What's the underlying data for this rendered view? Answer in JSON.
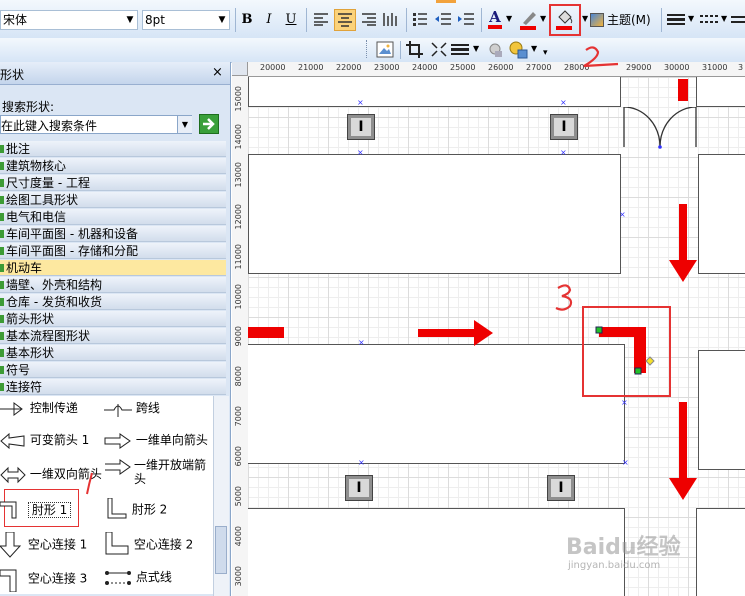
{
  "toolbar": {
    "font_name": "宋体",
    "font_size": "8pt",
    "bold": "B",
    "italic": "I",
    "underline": "U",
    "theme_label": "主题(M)",
    "accent_color": "#1f5fbf"
  },
  "panel": {
    "title": "形状",
    "close": "×",
    "search_label": "搜索形状:",
    "search_placeholder": "在此键入搜索条件",
    "categories": [
      {
        "label": "批注"
      },
      {
        "label": "建筑物核心"
      },
      {
        "label": "尺寸度量 - 工程"
      },
      {
        "label": "绘图工具形状"
      },
      {
        "label": "电气和电信"
      },
      {
        "label": "车间平面图 - 机器和设备"
      },
      {
        "label": "车间平面图 - 存储和分配"
      },
      {
        "label": "机动车"
      },
      {
        "label": "墙壁、外壳和结构"
      },
      {
        "label": "仓库 - 发货和收货"
      },
      {
        "label": "箭头形状"
      },
      {
        "label": "基本流程图形状"
      },
      {
        "label": "基本形状"
      },
      {
        "label": "符号"
      },
      {
        "label": "连接符"
      }
    ],
    "selected_category": "机动车",
    "shapes": [
      {
        "label": "控制传递"
      },
      {
        "label": "跨线"
      },
      {
        "label": "可变箭头 1"
      },
      {
        "label": "一维单向箭头"
      },
      {
        "label": "一维双向箭头"
      },
      {
        "label": "一维开放端箭头"
      },
      {
        "label": "肘形 1"
      },
      {
        "label": "肘形 2"
      },
      {
        "label": "空心连接 1"
      },
      {
        "label": "空心连接 2"
      },
      {
        "label": "空心连接 3"
      },
      {
        "label": "点式线"
      }
    ]
  },
  "ruler": {
    "h_ticks": [
      "20000",
      "21000",
      "22000",
      "23000",
      "24000",
      "25000",
      "26000",
      "27000",
      "28000",
      "29000",
      "30000",
      "31000",
      "3"
    ],
    "v_ticks": [
      "15000",
      "14000",
      "13000",
      "12000",
      "11000",
      "10000",
      "9000",
      "8000",
      "7000",
      "6000",
      "5000",
      "4000",
      "3000"
    ]
  },
  "annotations": {
    "two": "2",
    "three": "3",
    "one": "1"
  },
  "watermark": {
    "brand": "Baidu经验",
    "url": "jingyan.baidu.com"
  },
  "colors": {
    "arrow": "#ee0000",
    "highlight_box": "#e53333",
    "selected_category": "#fde8a0"
  }
}
